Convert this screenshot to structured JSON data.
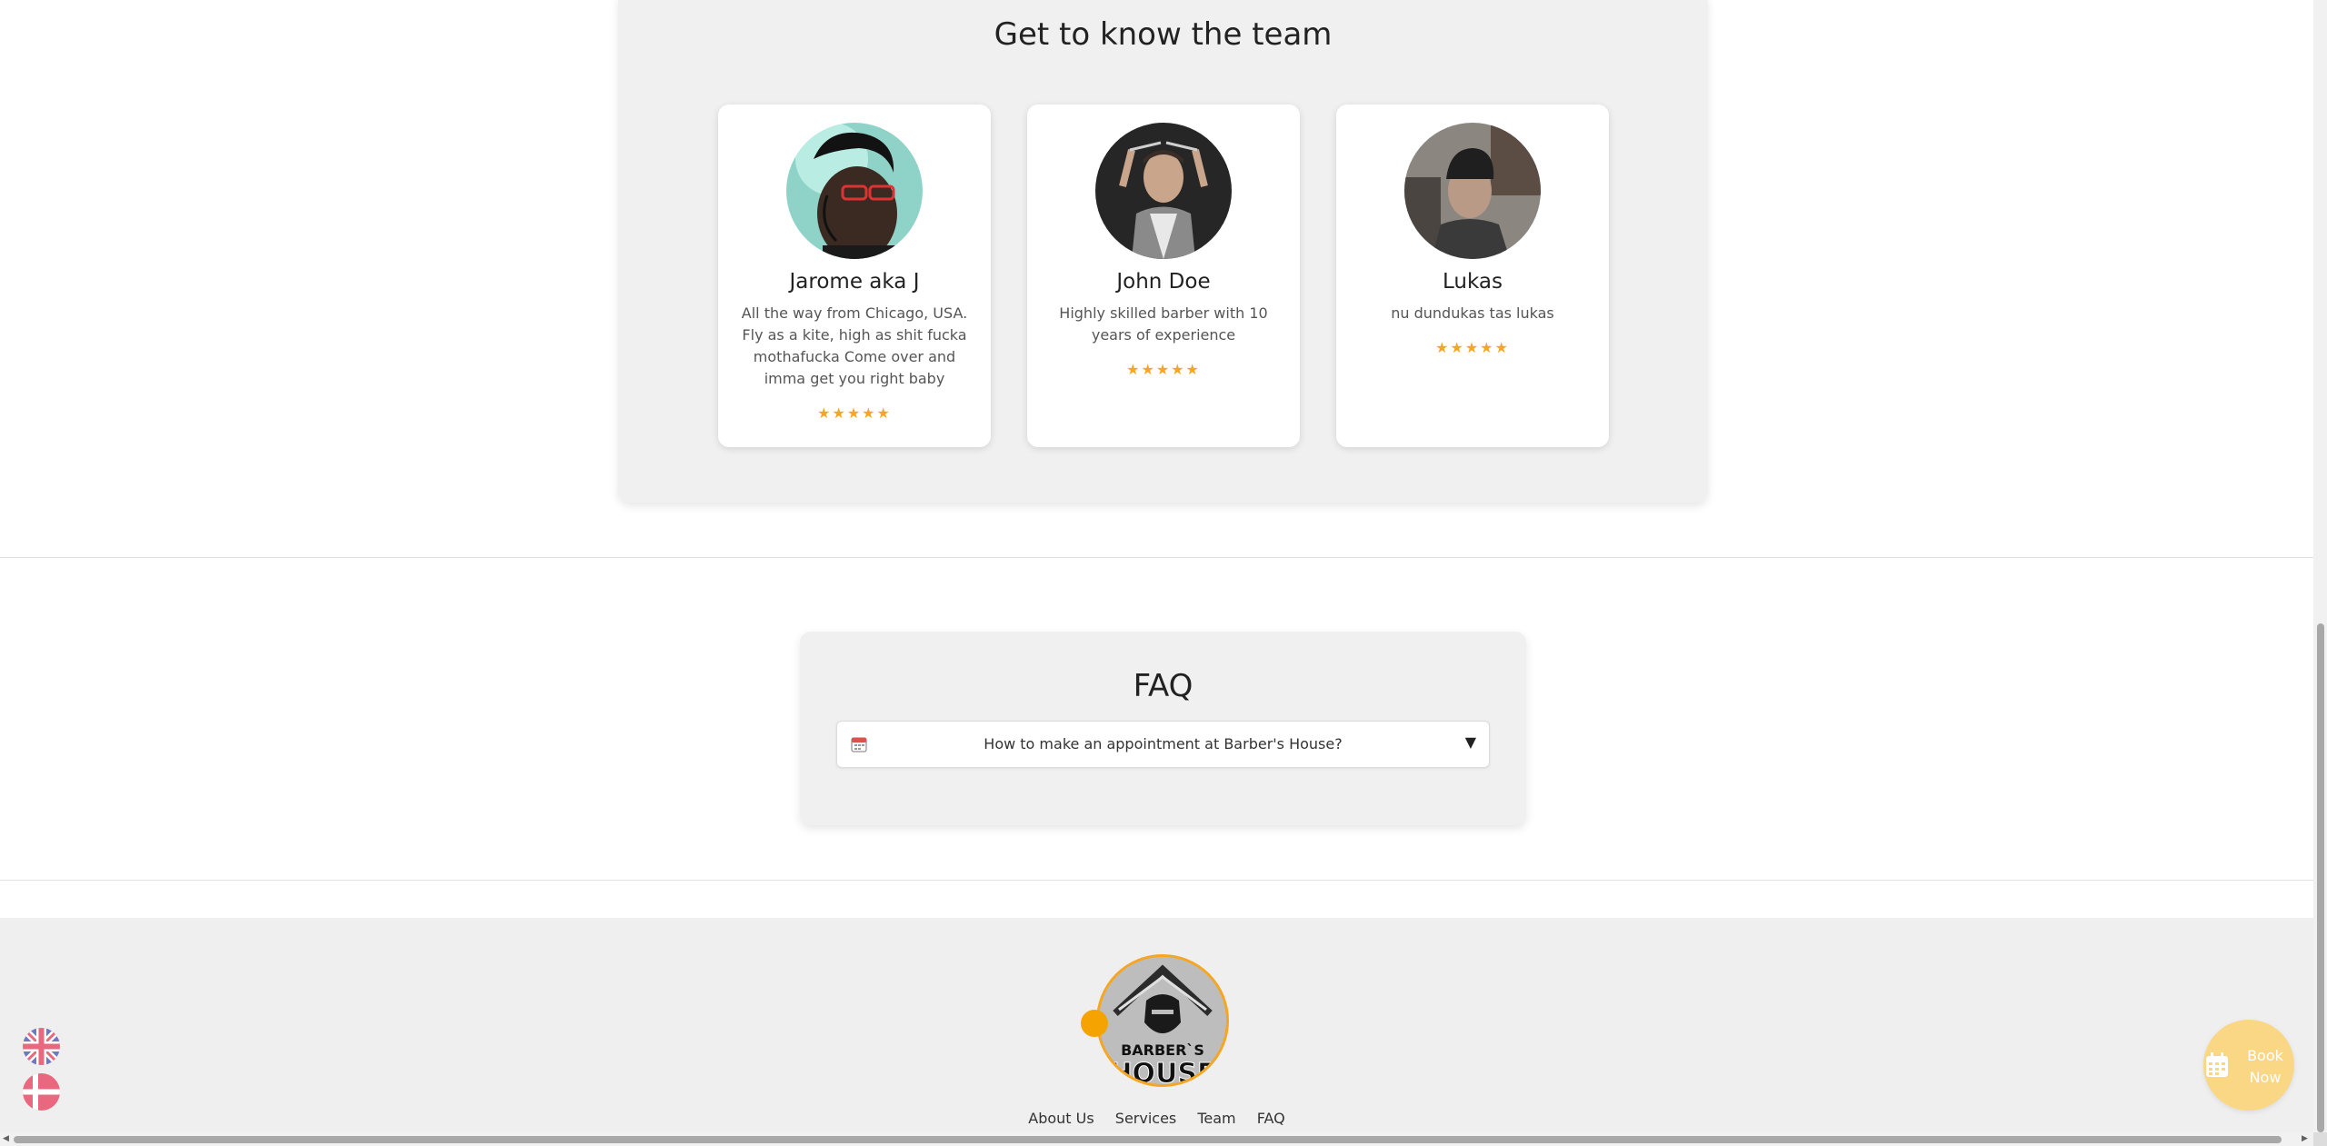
{
  "team": {
    "title": "Get to know the team",
    "members": [
      {
        "name": "Jarome aka J",
        "description": "All the way from Chicago, USA. Fly as a kite, high as shit fucka mothafucka Come over and imma get you right baby",
        "stars": "★★★★★",
        "rating": 5
      },
      {
        "name": "John Doe",
        "description": "Highly skilled barber with 10 years of experience",
        "stars": "★★★★★",
        "rating": 5
      },
      {
        "name": "Lukas",
        "description": "nu dundukas tas lukas",
        "stars": "★★★★★",
        "rating": 5
      }
    ]
  },
  "faq": {
    "title": "FAQ",
    "items": [
      {
        "question": "How to make an appointment at Barber's House?",
        "icon": "calendar-icon",
        "toggle": "▼"
      }
    ]
  },
  "footer": {
    "logo_text": "BARBER`S HOUSE",
    "nav": [
      "About Us",
      "Services",
      "Team",
      "FAQ"
    ]
  },
  "language": {
    "options": [
      {
        "code": "en",
        "icon": "uk-flag-icon"
      },
      {
        "code": "da",
        "icon": "denmark-flag-icon"
      }
    ]
  },
  "book_now": {
    "label": "Book Now",
    "icon": "calendar-icon"
  },
  "colors": {
    "accent": "#f5a623",
    "section_bg": "#f0f0f0",
    "book_now_bg": "#fad785",
    "flag_red": "#e9687f",
    "flag_blue": "#6e78c4"
  }
}
